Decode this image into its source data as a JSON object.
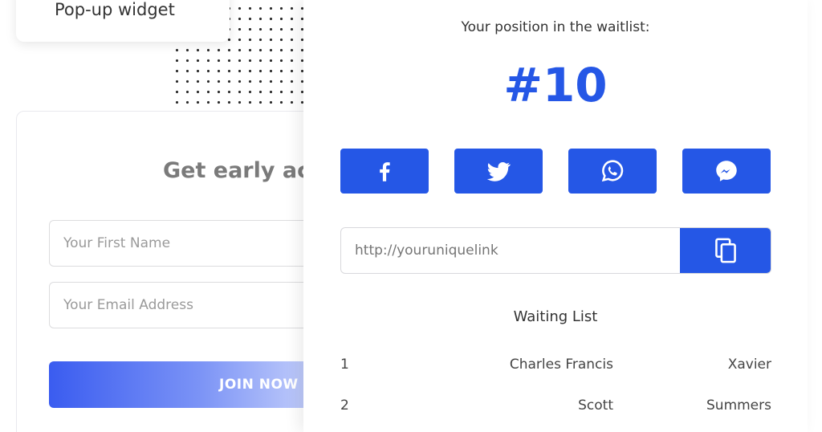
{
  "widget_card": {
    "label": "Pop-up widget"
  },
  "signup_form": {
    "heading": "Get early ac",
    "first_name_placeholder": "Your First Name",
    "email_placeholder": "Your Email Address",
    "join_label": "JOIN NOW"
  },
  "waitlist_panel": {
    "position_label": "Your position in the waitlist:",
    "position_value": "#10",
    "share_buttons": [
      {
        "icon": "facebook-icon"
      },
      {
        "icon": "twitter-icon"
      },
      {
        "icon": "whatsapp-icon"
      },
      {
        "icon": "messenger-icon"
      }
    ],
    "link_placeholder": "http://youruniquelink",
    "copy_icon": "copy-icon",
    "list_title": "Waiting List",
    "rows": [
      {
        "rank": "1",
        "first_name": "Charles Francis",
        "last_name": "Xavier"
      },
      {
        "rank": "2",
        "first_name": "Scott",
        "last_name": "Summers"
      }
    ]
  },
  "colors": {
    "accent": "#2557e6",
    "heading_gray": "#7a7a7a"
  }
}
